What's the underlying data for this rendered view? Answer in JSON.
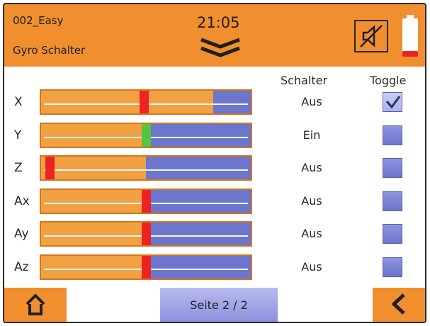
{
  "header": {
    "model_name": "002_Easy",
    "page_title": "Gyro Schalter",
    "time": "21:05"
  },
  "columns": {
    "switch": "Schalter",
    "toggle": "Toggle"
  },
  "rows": [
    {
      "axis": "X",
      "level": 0.49,
      "orange_fill": 0.82,
      "marker_color": "#ee2222",
      "state": "Aus",
      "toggle_checked": true
    },
    {
      "axis": "Y",
      "level": 0.5,
      "orange_fill": 0.52,
      "marker_color": "#55c440",
      "state": "Ein",
      "toggle_checked": false
    },
    {
      "axis": "Z",
      "level": 0.02,
      "orange_fill": 0.5,
      "marker_color": "#ee2222",
      "state": "Aus",
      "toggle_checked": false
    },
    {
      "axis": "Ax",
      "level": 0.5,
      "orange_fill": 0.5,
      "marker_color": "#ee2222",
      "state": "Aus",
      "toggle_checked": false
    },
    {
      "axis": "Ay",
      "level": 0.5,
      "orange_fill": 0.5,
      "marker_color": "#ee2222",
      "state": "Aus",
      "toggle_checked": false
    },
    {
      "axis": "Az",
      "level": 0.5,
      "orange_fill": 0.5,
      "marker_color": "#ee2222",
      "state": "Aus",
      "toggle_checked": false
    }
  ],
  "footer": {
    "page_label": "Seite 2 / 2"
  },
  "icons": {
    "home": "home-icon",
    "back": "chevron-left-icon",
    "menu": "chevron-down-double-icon",
    "mute": "speaker-muted-icon",
    "battery": "battery-low-icon"
  },
  "colors": {
    "accent": "#f18f2e",
    "bar_blue": "#6b76cc",
    "bar_orange": "#f1a042",
    "alert": "#ee2222",
    "ok": "#55c440"
  }
}
